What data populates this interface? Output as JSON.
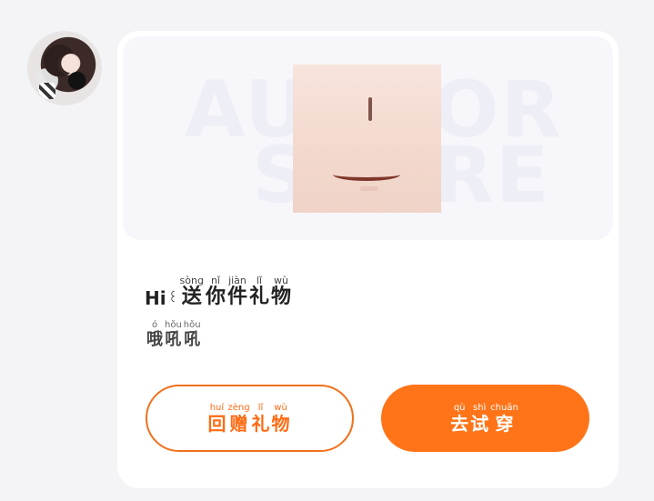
{
  "preview": {
    "watermark_line1": "AUTHOR",
    "watermark_line2": "STORE"
  },
  "greeting": {
    "hi": "Hi",
    "emoji": "꒰",
    "words": [
      {
        "py": "sòng",
        "hz": "送"
      },
      {
        "py": "nǐ",
        "hz": "你"
      },
      {
        "py": "jiàn",
        "hz": "件"
      },
      {
        "py": "lǐ",
        "hz": "礼"
      },
      {
        "py": "wù",
        "hz": "物"
      }
    ]
  },
  "subtext": {
    "words": [
      {
        "py": "ó",
        "hz": "哦"
      },
      {
        "py": "hǒu",
        "hz": "吼"
      },
      {
        "py": "hǒu",
        "hz": "吼"
      }
    ]
  },
  "buttons": {
    "gift": {
      "words": [
        {
          "py": "huí",
          "hz": "回"
        },
        {
          "py": "zèng",
          "hz": "赠"
        },
        {
          "py": "lǐ",
          "hz": "礼"
        },
        {
          "py": "wù",
          "hz": "物"
        }
      ]
    },
    "try_on": {
      "words": [
        {
          "py": "qù",
          "hz": "去"
        },
        {
          "py": "shì",
          "hz": "试"
        },
        {
          "py": "chuān",
          "hz": "穿"
        }
      ]
    }
  },
  "colors": {
    "accent": "#ff7418",
    "background": "#f4f4f6",
    "card": "#ffffff"
  }
}
